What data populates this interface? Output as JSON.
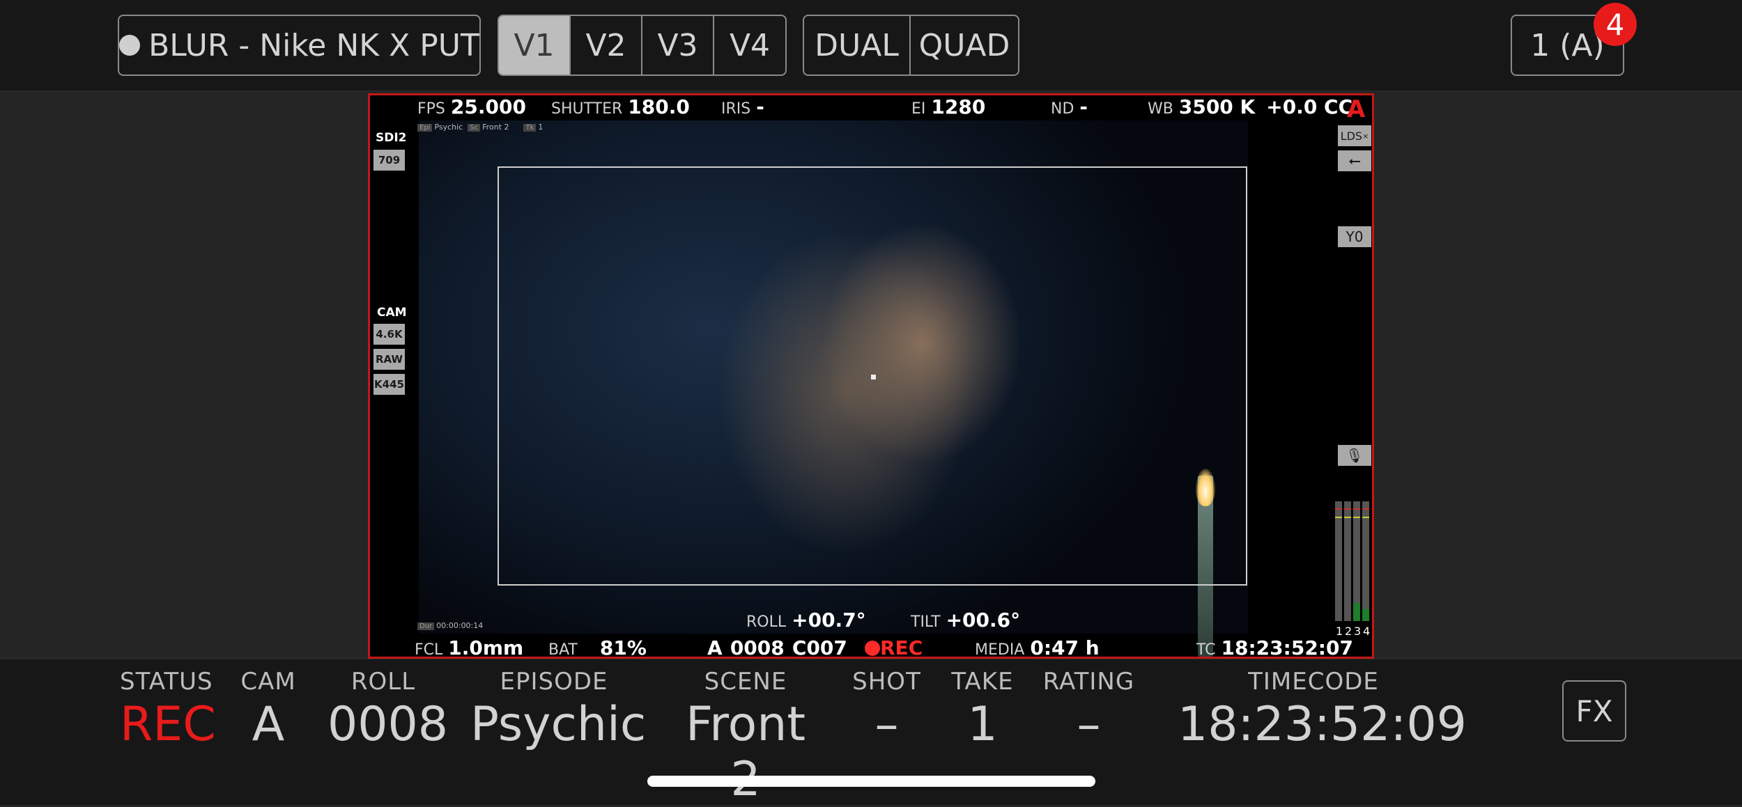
{
  "topbar": {
    "project_label": "BLUR - Nike NK X PUT",
    "views": [
      "V1",
      "V2",
      "V3",
      "V4"
    ],
    "active_view": "V1",
    "layouts": [
      "DUAL",
      "QUAD"
    ],
    "camera_selector": "1 (A)",
    "notification_count": "4"
  },
  "overlay": {
    "fps_label": "FPS",
    "fps": "25.000",
    "shutter_label": "SHUTTER",
    "shutter": "180.0",
    "iris_label": "IRIS",
    "iris": "-",
    "ei_label": "EI",
    "ei": "1280",
    "nd_label": "ND",
    "nd": "-",
    "wb_label": "WB",
    "wb": "3500 K",
    "cc": "+0.0 CC",
    "cam_letter": "A",
    "meta_tags": [
      "Psychic",
      "Front 2",
      "1"
    ],
    "sdi_label": "SDI2",
    "sdi_value": "709",
    "cam_label": "CAM",
    "cam_res": "4.6K",
    "cam_format": "RAW",
    "cam_model": "K445",
    "lds": "LDS",
    "y_label": "Y0",
    "meter_labels": [
      "1",
      "2",
      "3",
      "4"
    ],
    "meter_levels": [
      0.0,
      0.0,
      0.15,
      0.1
    ],
    "duration": "00:00:00:14",
    "roll_label": "ROLL",
    "roll": "+00.7°",
    "tilt_label": "TILT",
    "tilt": "+00.6°",
    "fcl_label": "FCL",
    "fcl": "1.0mm",
    "bat_label": "BAT",
    "bat": "81%",
    "clip_cam": "A",
    "clip_roll": "0008",
    "clip_id": "C007",
    "rec": "REC",
    "media_label": "MEDIA",
    "media": "0:47 h",
    "tc_label": "TC",
    "tc": "18:23:52:07"
  },
  "status_bar": {
    "status_label": "STATUS",
    "status": "REC",
    "cam_label": "CAM",
    "cam": "A",
    "roll_label": "ROLL",
    "roll": "0008",
    "episode_label": "EPISODE",
    "episode": "Psychic",
    "scene_label": "SCENE",
    "scene": "Front 2",
    "shot_label": "SHOT",
    "shot": "–",
    "take_label": "TAKE",
    "take": "1",
    "rating_label": "RATING",
    "rating": "–",
    "timecode_label": "TIMECODE",
    "timecode": "18:23:52:09",
    "fx": "FX"
  },
  "colors": {
    "accent_red": "#e81b1b",
    "rec_red": "#ff2a2a",
    "frame_red": "#c41616"
  }
}
